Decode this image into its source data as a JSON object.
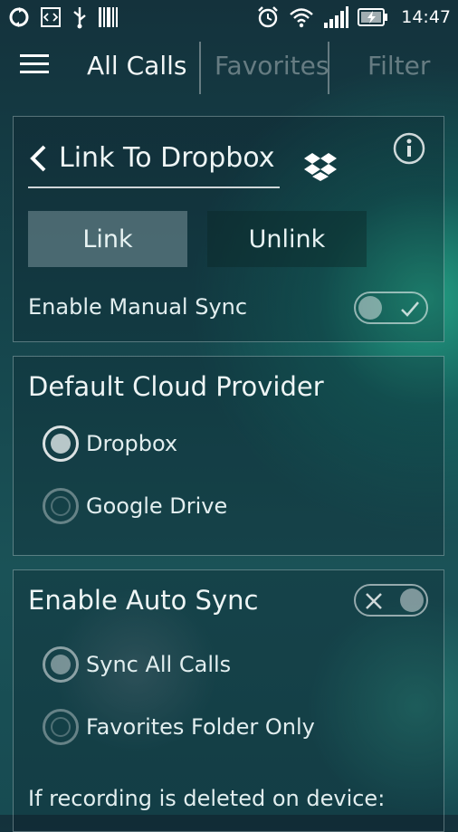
{
  "status_bar": {
    "time": "14:47",
    "left_icons": [
      "sync-icon",
      "code-icon",
      "usb-icon",
      "barcode-icon"
    ],
    "right_icons": [
      "alarm-icon",
      "wifi-icon",
      "signal-icon",
      "battery-charging-icon"
    ]
  },
  "app_bar": {
    "tabs": [
      {
        "label": "All Calls",
        "active": true
      },
      {
        "label": "Favorites",
        "active": false
      },
      {
        "label": "Filter",
        "active": false
      }
    ]
  },
  "link_card": {
    "title": "Link To Dropbox",
    "link_label": "Link",
    "unlink_label": "Unlink",
    "manual_sync_label": "Enable Manual Sync",
    "manual_sync_on": false
  },
  "cloud_card": {
    "title": "Default Cloud Provider",
    "options": [
      {
        "label": "Dropbox",
        "selected": true
      },
      {
        "label": "Google Drive",
        "selected": false
      }
    ]
  },
  "auto_sync_card": {
    "title": "Enable Auto Sync",
    "enabled": false,
    "options": [
      {
        "label": "Sync All Calls",
        "selected": true
      },
      {
        "label": "Favorites Folder Only",
        "selected": false
      }
    ],
    "footer_text": "If recording is deleted on device:"
  },
  "colors": {
    "background_dark": "#14323c",
    "accent_green": "#28be96",
    "text": "#eef5f5"
  }
}
